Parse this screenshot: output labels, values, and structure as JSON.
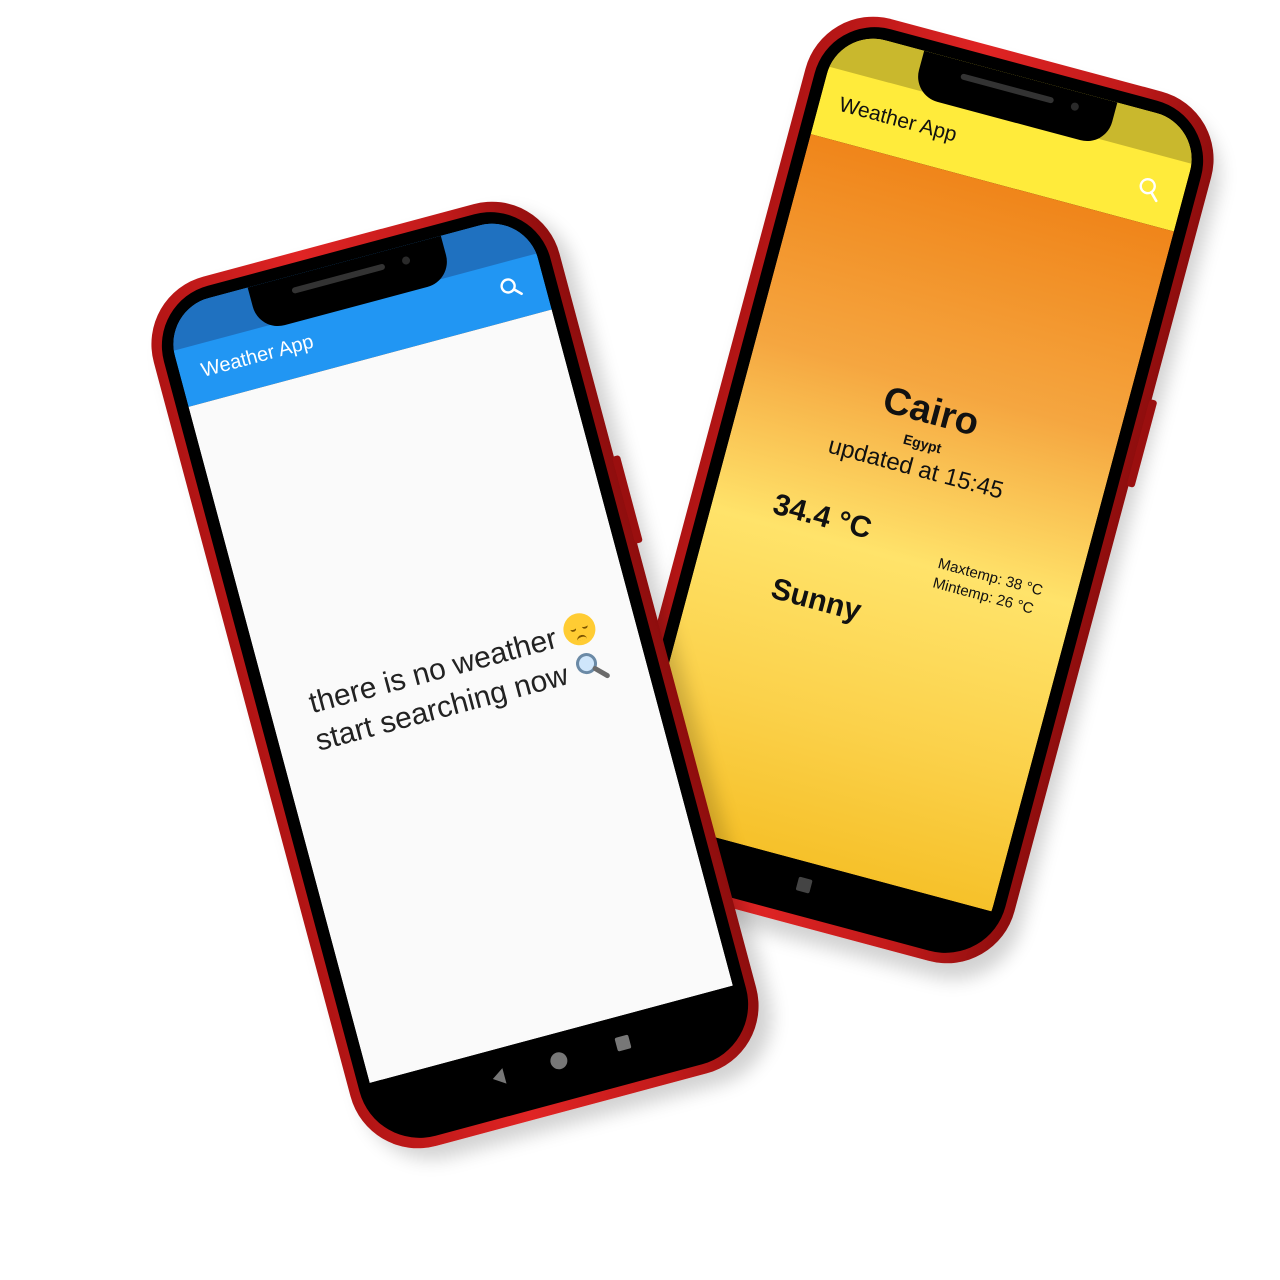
{
  "phone_yellow": {
    "app_title": "Weather App",
    "city": "Cairo",
    "country": "Egypt",
    "updated": "updated at 15:45",
    "temperature": "34.4 °C",
    "max_temp": "Maxtemp: 38 °C",
    "min_temp": "Mintemp: 26 °C",
    "condition": "Sunny",
    "colors": {
      "appbar": "#ffeb3b",
      "gradient_top": "#f0851a",
      "gradient_bottom": "#f6c12a"
    },
    "icons": {
      "search": "search-icon"
    }
  },
  "phone_blue": {
    "app_title": "Weather App",
    "message_part1": "there is no weather",
    "message_part2": "start searching now",
    "colors": {
      "appbar": "#2196f3",
      "body": "#fafafa"
    },
    "icons": {
      "search": "search-icon",
      "emoji_sad": "pensive-face-icon",
      "emoji_search": "magnifying-glass-icon"
    }
  },
  "frame": {
    "color": "#e02424"
  }
}
